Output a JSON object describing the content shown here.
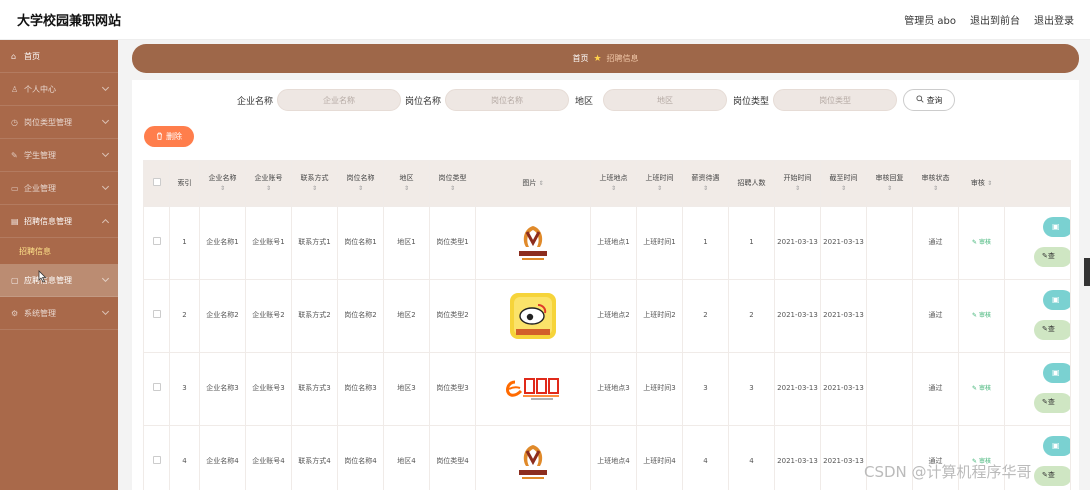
{
  "app": {
    "title": "大学校园兼职网站",
    "top_links": [
      "管理员 abo",
      "退出到前台",
      "退出登录"
    ]
  },
  "sidebar": {
    "items": [
      {
        "label": "首页",
        "icon": "home-icon",
        "glyph": "⌂"
      },
      {
        "label": "个人中心",
        "icon": "user-icon",
        "glyph": "♙"
      },
      {
        "label": "岗位类型管理",
        "icon": "clock-icon",
        "glyph": "◷"
      },
      {
        "label": "学生管理",
        "icon": "student-icon",
        "glyph": "✎"
      },
      {
        "label": "企业管理",
        "icon": "building-icon",
        "glyph": "▭"
      },
      {
        "label": "招聘信息管理",
        "icon": "list-icon",
        "glyph": "▤"
      },
      {
        "label": "应聘信息管理",
        "icon": "file-icon",
        "glyph": "▢"
      },
      {
        "label": "系统管理",
        "icon": "settings-icon",
        "glyph": "⚙"
      }
    ],
    "sub_item": "招聘信息"
  },
  "breadcrumb": {
    "home": "首页",
    "current": "招聘信息"
  },
  "search": {
    "fields": [
      {
        "label": "企业名称",
        "placeholder": "企业名称"
      },
      {
        "label": "岗位名称",
        "placeholder": "岗位名称"
      },
      {
        "label": "地区",
        "placeholder": "地区"
      },
      {
        "label": "岗位类型",
        "placeholder": "岗位类型"
      }
    ],
    "button": "查询"
  },
  "delete_button": "删除",
  "table": {
    "headers": [
      "索引",
      "企业名称",
      "企业账号",
      "联系方式",
      "岗位名称",
      "地区",
      "岗位类型",
      "图片",
      "上班地点",
      "上班时间",
      "薪资待遇",
      "招聘人数",
      "开始时间",
      "截至时间",
      "审核回复",
      "审核状态",
      "审核"
    ],
    "sortable": [
      false,
      true,
      true,
      true,
      true,
      true,
      true,
      true,
      true,
      true,
      true,
      false,
      true,
      true,
      true,
      true,
      true
    ],
    "rows": [
      {
        "idx": "1",
        "company": "企业名称1",
        "account": "企业账号1",
        "contact": "联系方式1",
        "job": "岗位名称1",
        "region": "地区1",
        "type": "岗位类型1",
        "logo": "gaosheng",
        "place": "上班地点1",
        "time": "上班时间1",
        "salary": "1",
        "count": "1",
        "start": "2021-03-13",
        "end": "2021-03-13",
        "reply": "",
        "status": "通过",
        "audit": "审核"
      },
      {
        "idx": "2",
        "company": "企业名称2",
        "account": "企业账号2",
        "contact": "联系方式2",
        "job": "岗位名称2",
        "region": "地区2",
        "type": "岗位类型2",
        "logo": "weibo",
        "place": "上班地点2",
        "time": "上班时间2",
        "salary": "2",
        "count": "2",
        "start": "2021-03-13",
        "end": "2021-03-13",
        "reply": "",
        "status": "通过",
        "audit": "审核"
      },
      {
        "idx": "3",
        "company": "企业名称3",
        "account": "企业账号3",
        "contact": "联系方式3",
        "job": "岗位名称3",
        "region": "地区3",
        "type": "岗位类型3",
        "logo": "alibaba",
        "place": "上班地点3",
        "time": "上班时间3",
        "salary": "3",
        "count": "3",
        "start": "2021-03-13",
        "end": "2021-03-13",
        "reply": "",
        "status": "通过",
        "audit": "审核"
      },
      {
        "idx": "4",
        "company": "企业名称4",
        "account": "企业账号4",
        "contact": "联系方式4",
        "job": "岗位名称4",
        "region": "地区4",
        "type": "岗位类型4",
        "logo": "gaosheng",
        "place": "上班地点4",
        "time": "上班时间4",
        "salary": "4",
        "count": "4",
        "start": "2021-03-13",
        "end": "2021-03-13",
        "reply": "",
        "status": "通过",
        "audit": "审核"
      }
    ],
    "op_buttons": [
      "",
      "查"
    ]
  },
  "watermark": "CSDN @计算机程序华哥",
  "colors": {
    "sidebar": "#a9694a",
    "accent": "#9e6749",
    "delete": "#ff7e4c",
    "audit": "#3bb273",
    "submenu_active": "#ffe38a"
  }
}
